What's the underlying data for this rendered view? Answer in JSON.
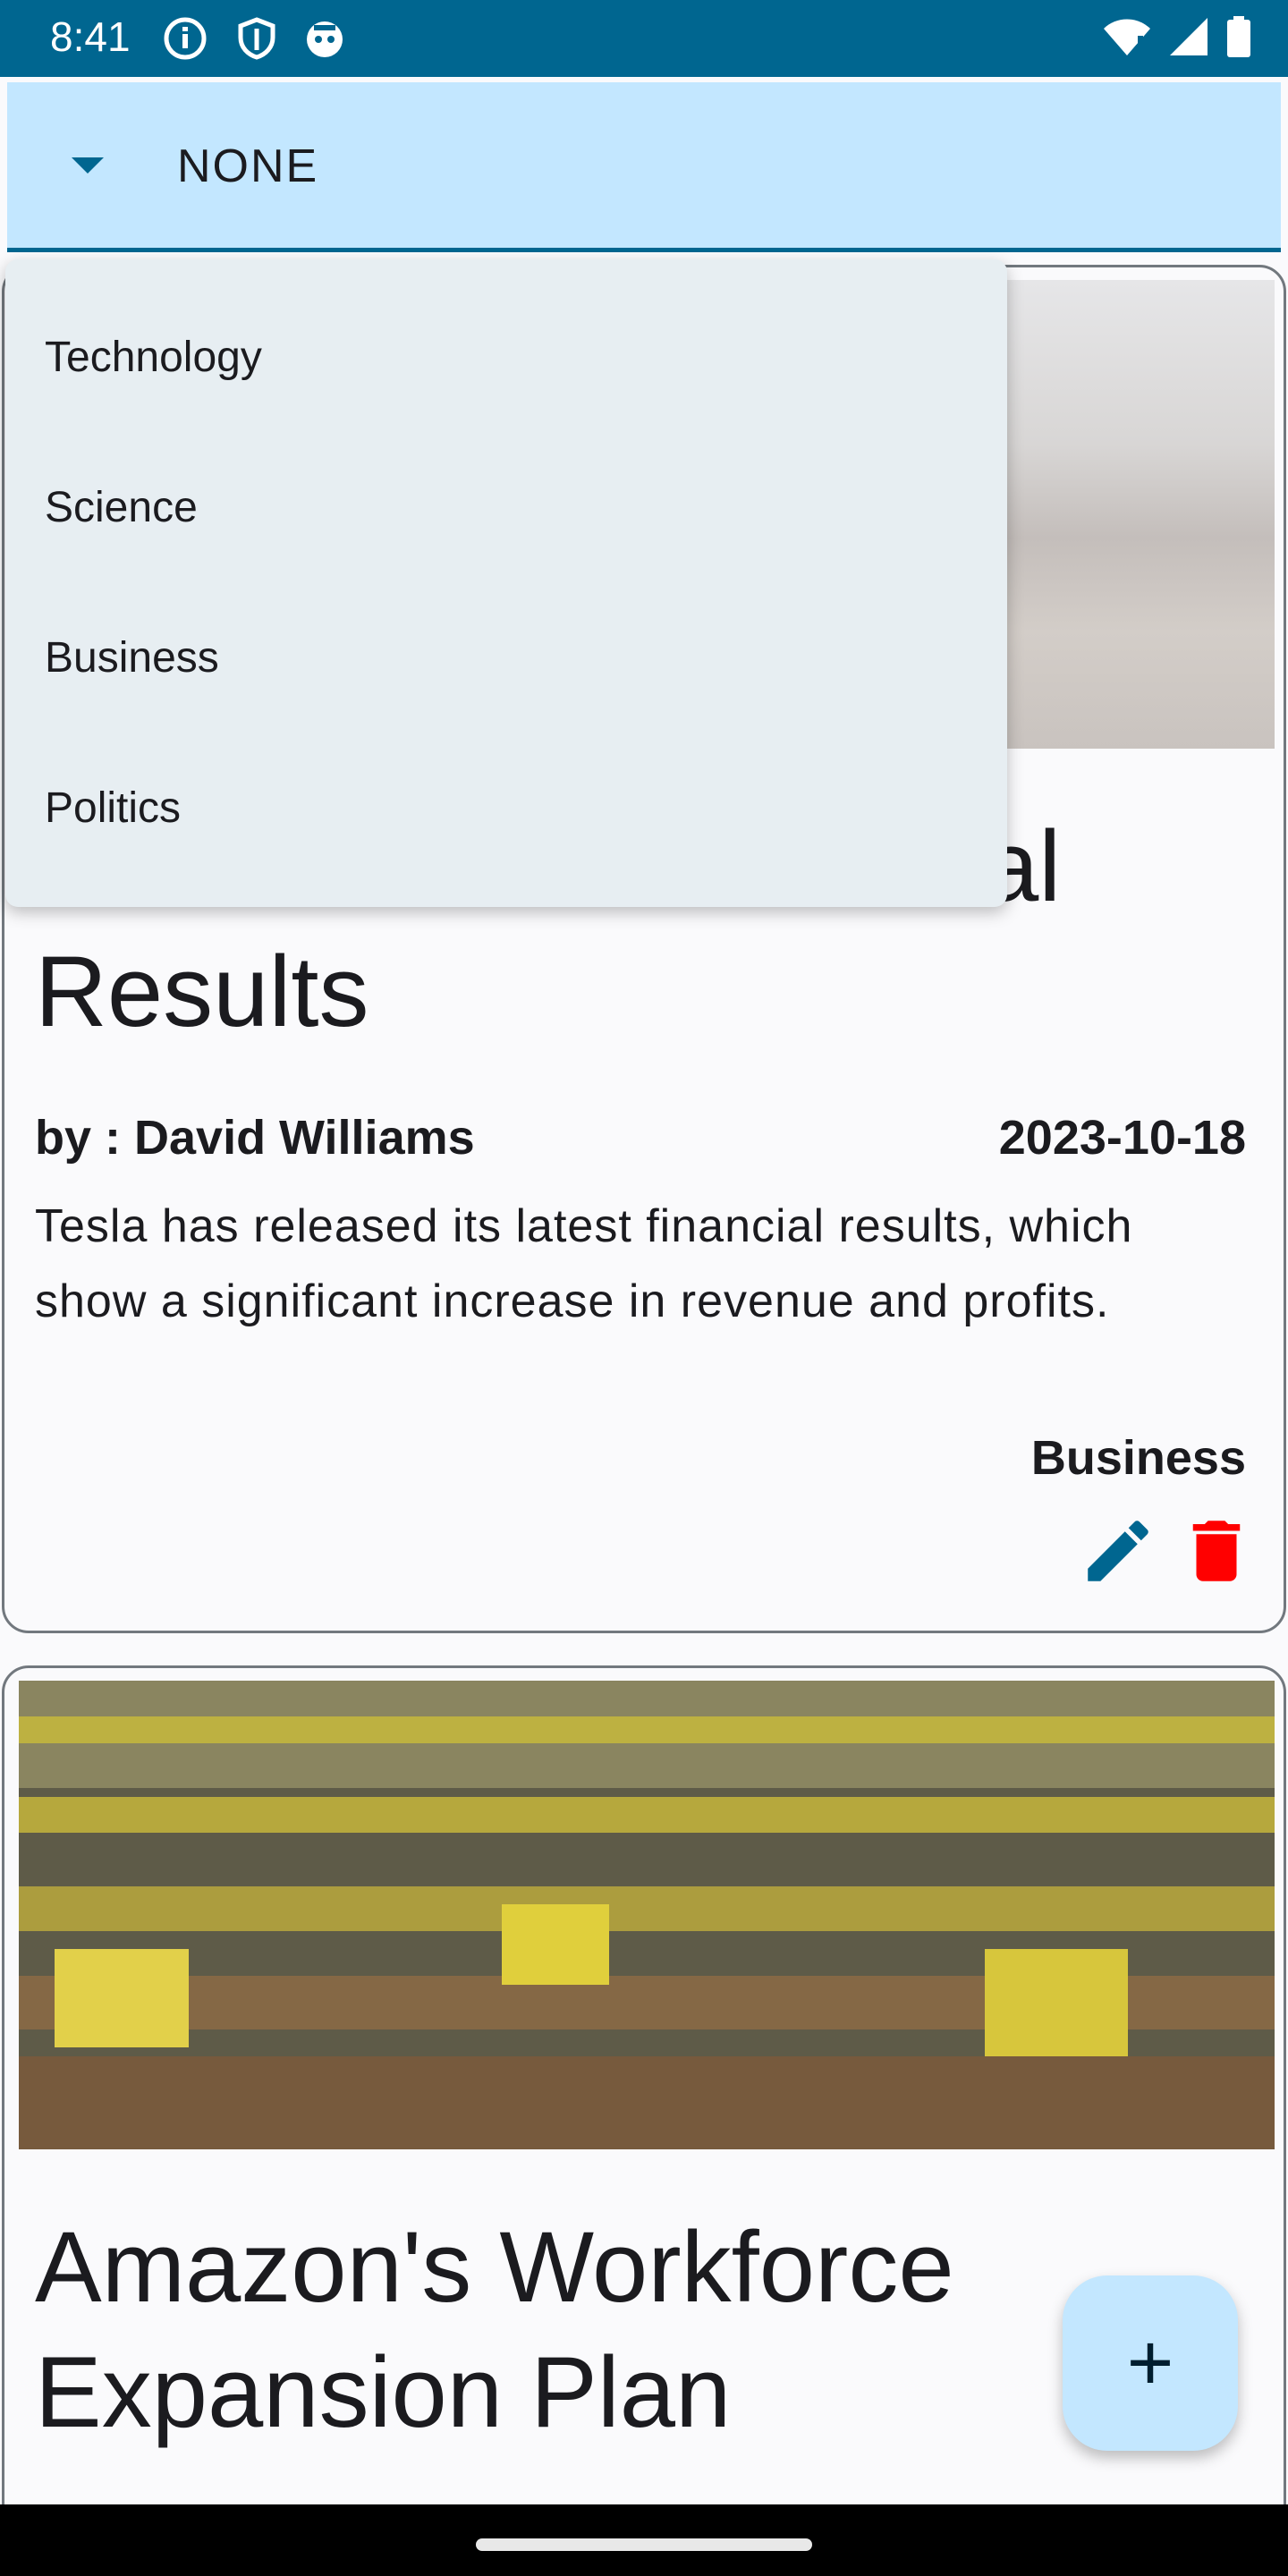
{
  "status_bar": {
    "time": "8:41",
    "left_icons": [
      "info-icon",
      "shield-icon",
      "face-icon"
    ],
    "right_icons": [
      "wifi-icon",
      "signal-icon",
      "battery-icon"
    ]
  },
  "filter": {
    "selected": "NONE",
    "options": [
      "Technology",
      "Science",
      "Business",
      "Politics"
    ]
  },
  "articles": [
    {
      "title_visible": "al",
      "title_line2": "Results",
      "author": "by : David Williams",
      "date": "2023-10-18",
      "description": "Tesla has released its latest financial results, which show a significant increase in revenue and profits.",
      "category": "Business",
      "actions": [
        "edit-icon",
        "delete-icon"
      ]
    },
    {
      "title": "Amazon's Workforce Expansion Plan"
    }
  ],
  "fab": {
    "label": "+"
  },
  "colors": {
    "primary": "#006690",
    "primary_container": "#c3e7ff",
    "delete": "#ff0000",
    "surface": "#fafafc"
  }
}
